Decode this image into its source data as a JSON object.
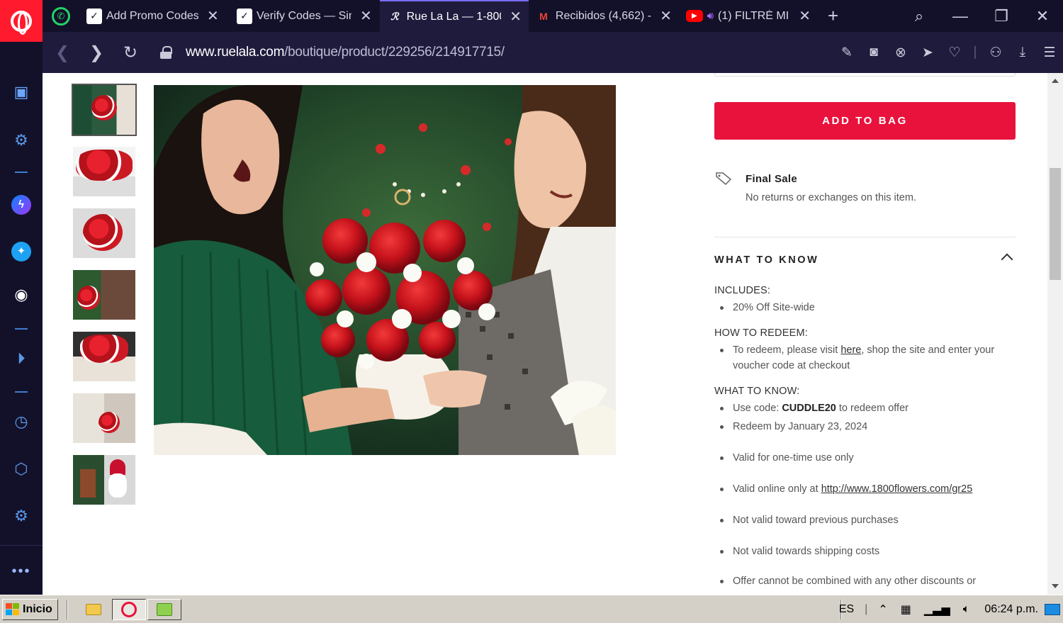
{
  "browser": {
    "tabs": [
      {
        "title": "Add Promo Codes",
        "icon": "whatsapp-square-icon"
      },
      {
        "title": "Verify Codes — Sim",
        "icon": "whatsapp-square-icon"
      },
      {
        "title": "Rue La La — 1-800",
        "icon": "ruelala-icon",
        "active": true
      },
      {
        "title": "Recibidos (4,662) -",
        "icon": "gmail-icon"
      },
      {
        "title": "(1) FILTRÈ MI",
        "icon": "youtube-icon"
      }
    ],
    "url_host": "www.ruelala.com",
    "url_path": "/boutique/product/229256/214917715/"
  },
  "product": {
    "add_to_bag": "ADD TO BAG",
    "final_sale_title": "Final Sale",
    "final_sale_sub": "No returns or exchanges on this item.",
    "what_to_know_heading": "WHAT TO KNOW",
    "includes_heading": "INCLUDES:",
    "includes_item": "20% Off Site-wide",
    "redeem_heading": "HOW TO REDEEM:",
    "redeem_text_before": "To redeem, please visit ",
    "redeem_link": "here",
    "redeem_text_after": ", shop the site and enter your voucher code at checkout",
    "wtk_heading": "WHAT TO KNOW:",
    "code_before": "Use code: ",
    "code": "CUDDLE20",
    "code_after": " to redeem offer",
    "redeem_by": "Redeem by January 23, 2024",
    "one_time": "Valid for one-time use only",
    "online_before": "Valid online only at ",
    "online_link": "http://www.1800flowers.com/gr25",
    "previous": "Not valid toward previous purchases",
    "shipping": "Not valid towards shipping costs",
    "combined": "Offer cannot be combined with any other discounts or"
  },
  "taskbar": {
    "start_label": "Inicio",
    "language": "ES",
    "clock": "06:24 p.m."
  },
  "colors": {
    "brand_red": "#e8123c",
    "browser_dark": "#13112a",
    "browser_bar": "#1f1b3d",
    "opera_red": "#ff1b2d"
  }
}
